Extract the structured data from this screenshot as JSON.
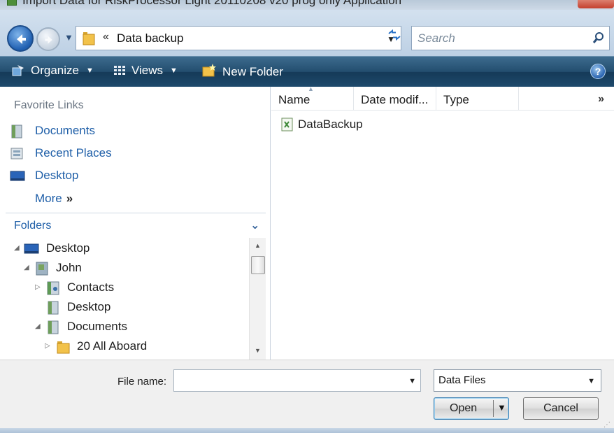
{
  "window": {
    "title": "Import Data for RiskProcessor Light 20110208 v20 prog only Application"
  },
  "address_bar": {
    "breadcrumb_chevron": "«",
    "path": "Data backup",
    "search_placeholder": "Search"
  },
  "command_bar": {
    "organize_label": "Organize",
    "views_label": "Views",
    "new_folder_label": "New Folder",
    "help_label": "?"
  },
  "nav_pane": {
    "favorite_links_heading": "Favorite Links",
    "favorites": [
      {
        "label": "Documents",
        "icon": "documents-icon"
      },
      {
        "label": "Recent Places",
        "icon": "recent-places-icon"
      },
      {
        "label": "Desktop",
        "icon": "desktop-icon"
      }
    ],
    "more_label": "More",
    "more_chevron": "»",
    "folders_heading": "Folders",
    "tree": [
      {
        "label": "Desktop",
        "expanded": true,
        "icon": "desktop-icon"
      },
      {
        "label": "John",
        "expanded": true,
        "icon": "user-folder-icon"
      },
      {
        "label": "Contacts",
        "expanded": false,
        "icon": "contacts-icon"
      },
      {
        "label": "Desktop",
        "expanded": null,
        "icon": "desktop-folder-icon"
      },
      {
        "label": "Documents",
        "expanded": true,
        "icon": "documents-icon"
      },
      {
        "label": "20 All Aboard",
        "expanded": false,
        "icon": "folder-icon"
      }
    ]
  },
  "file_list": {
    "columns": [
      "Name",
      "Date modif...",
      "Type"
    ],
    "more_columns": "»",
    "files": [
      {
        "name": "DataBackup",
        "icon": "spreadsheet-file-icon"
      }
    ]
  },
  "footer": {
    "file_name_label": "File name:",
    "file_name_value": "",
    "file_type_selected": "Data Files",
    "open_label": "Open",
    "cancel_label": "Cancel"
  },
  "colors": {
    "command_bar": "#1e4a6c",
    "link_blue": "#1f5fa8",
    "address_bar": "#c8d8ea"
  }
}
